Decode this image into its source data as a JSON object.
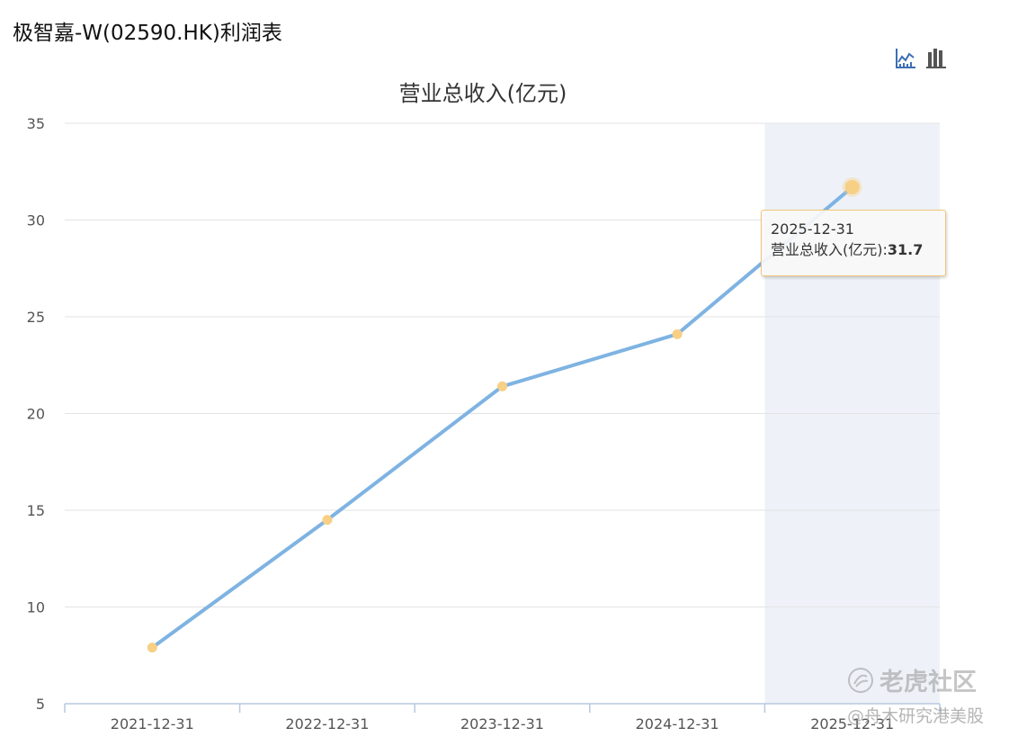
{
  "header": {
    "title": "极智嘉-W(02590.HK)利润表"
  },
  "toolbar": {
    "line_chart_icon": "line-chart-icon",
    "bar_chart_icon": "bar-chart-icon"
  },
  "tooltip": {
    "date": "2025-12-31",
    "label": "营业总收入(亿元):",
    "value": "31.7"
  },
  "watermark": {
    "brand": "老虎社区",
    "sub": "@舟木研究港美股"
  },
  "colors": {
    "line": "#7eb3e2",
    "marker": "#f7cf85",
    "highlight_band": "#eef2f8",
    "grid": "#e3e3e3",
    "axis": "#b8c8e0",
    "icon": "#3c6eb4"
  },
  "chart_data": {
    "type": "line",
    "title": "营业总收入(亿元)",
    "categories": [
      "2021-12-31",
      "2022-12-31",
      "2023-12-31",
      "2024-12-31",
      "2025-12-31"
    ],
    "series": [
      {
        "name": "营业总收入(亿元)",
        "values": [
          7.9,
          14.5,
          21.4,
          24.1,
          31.7
        ]
      }
    ],
    "ylim": [
      5,
      35
    ],
    "yticks": [
      "35",
      "30",
      "25",
      "20",
      "15",
      "10",
      "5"
    ],
    "grid": true,
    "highlighted_category": "2025-12-31"
  }
}
